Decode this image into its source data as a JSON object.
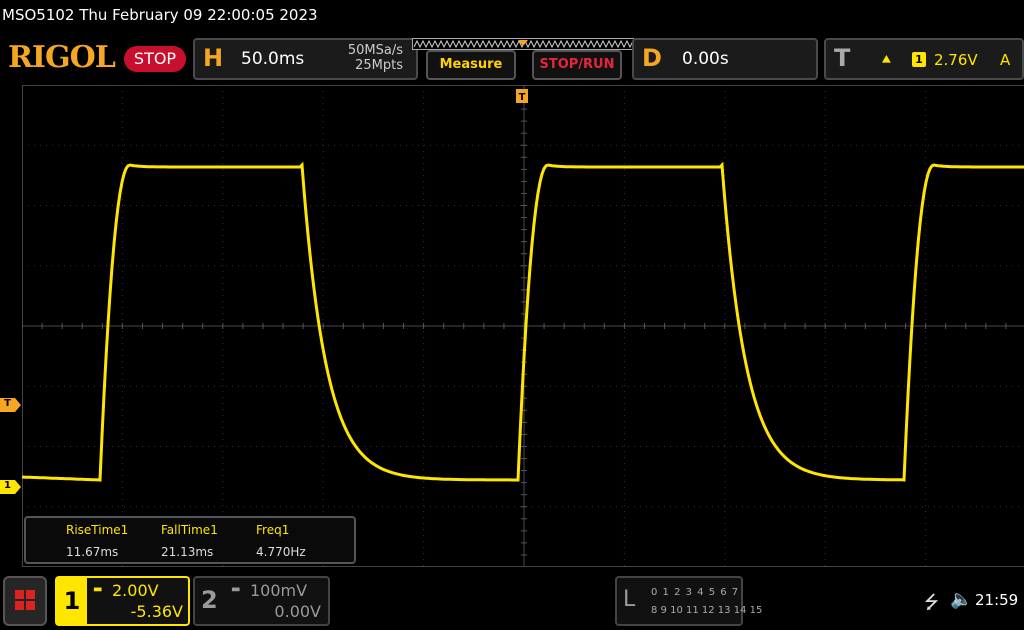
{
  "title_bar": {
    "text": "MSO5102  Thu February 09 22:00:05 2023"
  },
  "brand": {
    "name": "RIGOL",
    "run_state": "STOP"
  },
  "horizontal": {
    "letter": "H",
    "time_scale": "50.0ms",
    "sample_rate": "50MSa/s",
    "memory_depth": "25Mpts"
  },
  "menu": {
    "measure": "Measure",
    "stop_run": "STOP/RUN"
  },
  "delay": {
    "letter": "D",
    "value": "0.00s"
  },
  "trigger": {
    "letter": "T",
    "edge_icon": "rising-edge-icon",
    "source": "1",
    "level": "2.76V",
    "mode": "A",
    "marker": "T"
  },
  "channel1": {
    "number": "1",
    "coupling_icon": "dc-coupling-icon",
    "scale": "2.00V",
    "offset": "-5.36V",
    "marker": "1",
    "color": "#ffe600"
  },
  "channel2": {
    "number": "2",
    "coupling_icon": "dc-coupling-icon",
    "scale": "100mV",
    "offset": "0.00V"
  },
  "measurements": [
    {
      "label": "RiseTime1",
      "value": "11.67ms"
    },
    {
      "label": "FallTime1",
      "value": "21.13ms"
    },
    {
      "label": "Freq1",
      "value": "4.770Hz"
    }
  ],
  "logic_analyzer": {
    "letter": "L",
    "row1": "0 1 2 3  4 5 6 7",
    "row2": "8  9 10 11 12 13 14 15"
  },
  "status": {
    "usb_icon": "usb-icon",
    "speaker_icon": "speaker-muted-icon",
    "clock": "21:59"
  },
  "colors": {
    "accent": "#f5a623",
    "stop_badge": "#c8102e",
    "trace": "#ffe600",
    "grid": "#3a3a3a"
  }
}
